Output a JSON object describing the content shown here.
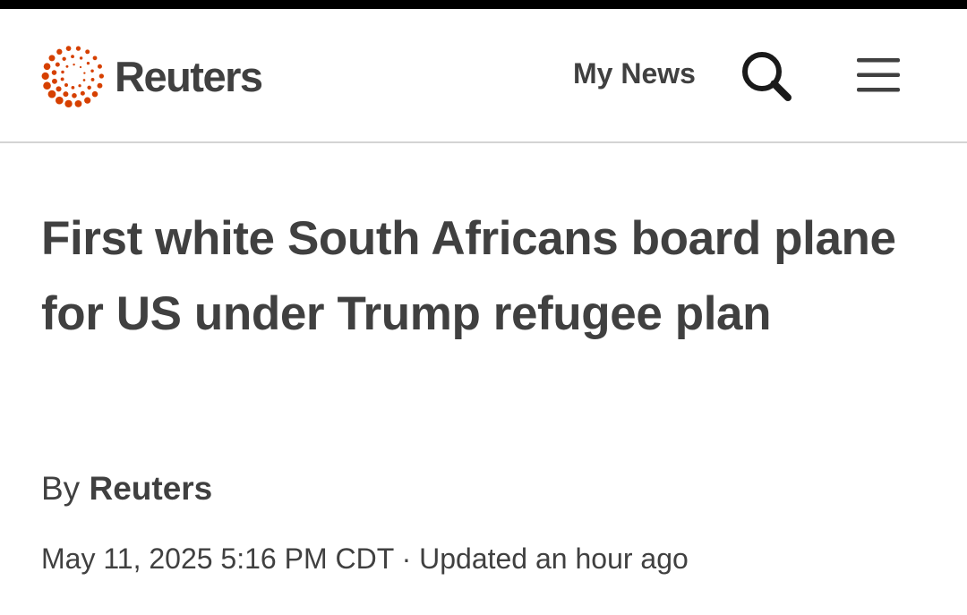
{
  "header": {
    "brand": "Reuters",
    "logo_icon": "reuters-dotted-circle-logo",
    "my_news_label": "My News",
    "search_icon": "search-icon",
    "menu_icon": "hamburger-menu-icon"
  },
  "article": {
    "headline": "First white South Africans board plane for US under Trump refugee plan",
    "byline_prefix": "By",
    "author": "Reuters",
    "published": "May 11, 2025 5:16 PM CDT",
    "separator": "·",
    "updated": "Updated an hour ago"
  },
  "colors": {
    "brand_orange": "#D64000",
    "text": "#404040",
    "divider": "#d4d4d4"
  }
}
